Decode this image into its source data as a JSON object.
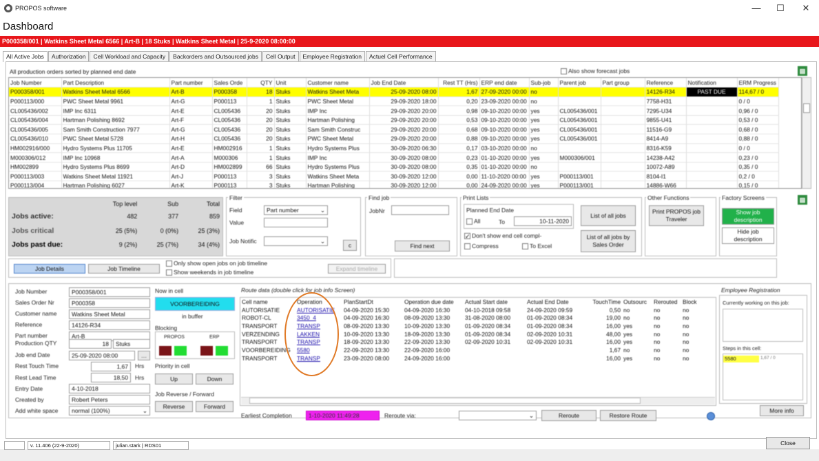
{
  "window": {
    "app_title": "PROPOS software",
    "minimize": "—",
    "maximize": "☐",
    "close": "✕"
  },
  "page_title": "Dashboard",
  "red_bar": "P000358/001  |  Watkins Sheet Metal 6566  |  Art-B  |  18 Stuks  |  Watkins Sheet Metal  |  25-9-2020 08:00:00",
  "tabs": [
    "All Active Jobs",
    "Authorization",
    "Cell Workload and Capacity",
    "Backorders and Outsourced jobs",
    "Cell Output",
    "Employee Registration",
    "Actuel Cell Performance"
  ],
  "grid": {
    "subtitle": "All production orders sorted by planned end date",
    "forecast_label": "Also show forecast jobs",
    "columns": [
      "Job Number",
      "Part Description",
      "Part number",
      "Sales Orde",
      "QTY",
      "Unit",
      "Customer name",
      "Job End Date",
      "Rest TT (Hrs)",
      "ERP end date",
      "Sub-job",
      "Parent job",
      "Part group",
      "Reference",
      "Notification",
      "ERM Progress"
    ],
    "rows": [
      [
        "P000358/001",
        "Watkins Sheet Metal 6566",
        "Art-B",
        "P000358",
        "18",
        "Stuks",
        "Watkins Sheet Meta",
        "25-09-2020 08:00",
        "1,67",
        "27-09-2020 00:00",
        "no",
        "",
        "",
        "14126-R34",
        "PAST DUE",
        "114,67 / 0"
      ],
      [
        "P000113/000",
        "PWC Sheet Metal 9961",
        "Art-G",
        "P000113",
        "1",
        "Stuks",
        "PWC Sheet Metal",
        "29-09-2020 18:00",
        "0,20",
        "23-09-2020 00:00",
        "no",
        "",
        "",
        "7758-H31",
        "",
        "0 / 0"
      ],
      [
        "CL005436/002",
        "IMP Inc 6311",
        "Art-E",
        "CL005436",
        "20",
        "Stuks",
        "IMP Inc",
        "29-09-2020 20:00",
        "0,98",
        "09-10-2020 00:00",
        "yes",
        "CL005436/001",
        "",
        "7295-U34",
        "",
        "0,96 / 0"
      ],
      [
        "CL005436/004",
        "Hartman Polishing 8692",
        "Art-F",
        "CL005436",
        "20",
        "Stuks",
        "Hartman Polishing",
        "29-09-2020 20:00",
        "0,53",
        "09-10-2020 00:00",
        "yes",
        "CL005436/001",
        "",
        "9855-U41",
        "",
        "0,53 / 0"
      ],
      [
        "CL005436/005",
        "Sam Smith Construction 7977",
        "Art-G",
        "CL005436",
        "20",
        "Stuks",
        "Sam Smith Construc",
        "29-09-2020 20:00",
        "0,68",
        "09-10-2020 00:00",
        "yes",
        "CL005436/001",
        "",
        "11516-G9",
        "",
        "0,68 / 0"
      ],
      [
        "CL005436/010",
        "PWC Sheet Metal 5728",
        "Art-H",
        "CL005436",
        "20",
        "Stuks",
        "PWC Sheet Metal",
        "29-09-2020 20:00",
        "0,88",
        "09-10-2020 00:00",
        "yes",
        "CL005436/001",
        "",
        "8414-A9",
        "",
        "0,88 / 0"
      ],
      [
        "HM002916/000",
        "Hydro Systems Plus 11705",
        "Art-E",
        "HM002916",
        "1",
        "Stuks",
        "Hydro Systems Plus",
        "30-09-2020 06:30",
        "0,17",
        "03-10-2020 00:00",
        "no",
        "",
        "",
        "8316-K59",
        "",
        "0 / 0"
      ],
      [
        "M000306/012",
        "IMP Inc 10968",
        "Art-A",
        "M000306",
        "1",
        "Stuks",
        "IMP Inc",
        "30-09-2020 08:00",
        "0,23",
        "01-10-2020 00:00",
        "yes",
        "M000306/001",
        "",
        "14238-A42",
        "",
        "0,23 / 0"
      ],
      [
        "HM002899",
        "Hydro Systems Plus 8699",
        "Art-D",
        "HM002899",
        "66",
        "Stuks",
        "Hydro Systems Plus",
        "30-09-2020 08:00",
        "0,35",
        "01-10-2020 00:00",
        "no",
        "",
        "",
        "10072-A89",
        "",
        "0,35 / 0"
      ],
      [
        "P000113/003",
        "Watkins Sheet Metal 11921",
        "Art-J",
        "P000113",
        "3",
        "Stuks",
        "Watkins Sheet Meta",
        "30-09-2020 12:00",
        "0,00",
        "11-10-2020 00:00",
        "yes",
        "P000113/001",
        "",
        "8104-I1",
        "",
        "0,2 / 0"
      ],
      [
        "P000113/004",
        "Hartman Polishing 6027",
        "Art-K",
        "P000113",
        "3",
        "Stuks",
        "Hartman Polishing",
        "30-09-2020 12:00",
        "0,00",
        "24-09-2020 00:00",
        "yes",
        "P000113/001",
        "",
        "14886-W66",
        "",
        "0,15 / 0"
      ]
    ]
  },
  "stats": {
    "headers": [
      "Top level",
      "Sub",
      "Total"
    ],
    "rows": [
      {
        "label": "Jobs active:",
        "top": "482",
        "sub": "377",
        "total": "859"
      },
      {
        "label": "Jobs critical",
        "top": "25 (5%)",
        "sub": "0 (0%)",
        "total": "25 (3%)"
      },
      {
        "label": "Jobs past due:",
        "top": "9 (2%)",
        "sub": "25 (7%)",
        "total": "34 (4%)"
      }
    ]
  },
  "filter": {
    "title": "Filter",
    "field_label": "Field",
    "field_value": "Part number",
    "value_label": "Value",
    "notific_label": "Job Notific",
    "c_button": "c"
  },
  "find_job": {
    "title": "Find job",
    "jobnr_label": "JobNr",
    "find_next": "Find next"
  },
  "print_lists": {
    "title": "Print Lists",
    "planned_end_date": "Planned End Date",
    "all_label": "All",
    "to_label": "To",
    "to_date": "10-11-2020",
    "dont_show": "Don't show end cell compl-",
    "compress": "Compress",
    "to_excel": "To Excel",
    "list_all_jobs": "List of all jobs",
    "list_by_so": "List of all jobs by Sales Order"
  },
  "other_functions": {
    "title": "Other Functions",
    "print_traveler": "Print PROPOS job Traveler"
  },
  "factory_screens": {
    "title": "Factory Screens",
    "show_desc": "Show job description",
    "hide_desc": "Hide job description"
  },
  "job_tabs": {
    "details": "Job Details",
    "timeline": "Job Timeline",
    "only_open": "Only show open jobs on job timeline",
    "show_weekends": "Show weekends in job timeline",
    "expand": "Expand timeline"
  },
  "details": {
    "fields": [
      {
        "label": "Job Number",
        "value": "P000358/001"
      },
      {
        "label": "Sales Order Nr",
        "value": "P000358"
      },
      {
        "label": "Customer name",
        "value": "Watkins Sheet Metal"
      },
      {
        "label": "Reference",
        "value": "14126-R34"
      },
      {
        "label": "Part number",
        "value": "Art-B"
      }
    ],
    "prod_qty_label": "Production QTY",
    "prod_qty": "18",
    "prod_unit": "Stuks",
    "end_date_label": "Job end Date",
    "end_date": "25-09-2020 08:00",
    "rest_touch_label": "Rest Touch Time",
    "rest_touch": "1,67",
    "hrs": "Hrs",
    "rest_lead_label": "Rest Lead Time",
    "rest_lead": "18,50",
    "entry_label": "Entry Date",
    "entry": "4-10-2018",
    "created_label": "Created by",
    "created": "Robert Peters",
    "white_space_label": "Add white space",
    "white_space": "normal (100%)"
  },
  "now_in_cell": {
    "title": "Now in cell",
    "cell": "VOORBEREIDING",
    "status": "in buffer",
    "blocking": "Blocking",
    "propos": "PROPOS",
    "erp": "ERP",
    "priority": "Priority in cell",
    "up": "Up",
    "down": "Down",
    "reverse_title": "Job Reverse / Forward",
    "reverse": "Reverse",
    "forward": "Forward"
  },
  "route": {
    "title": "Route data (double click for job info Screen)",
    "columns": [
      "Cell name",
      "Operation",
      "PlanStartDt",
      "Operation due date",
      "Actual Start date",
      "Actual End Date",
      "TouchTime",
      "Outsourc",
      "Rerouted",
      "Block"
    ],
    "rows": [
      [
        "AUTORISATIE",
        "AUTORISATIE",
        "04-09-2020 15:30",
        "04-09-2020 16:30",
        "04-10-2018 09:58",
        "24-09-2020 09:59",
        "0,50",
        "no",
        "no",
        "no"
      ],
      [
        "ROBOT-CL",
        "3450_4",
        "04-09-2020 16:30",
        "08-09-2020 13:30",
        "31-08-2020 08:00",
        "01-09-2020 08:34",
        "19,00",
        "no",
        "no",
        "no"
      ],
      [
        "TRANSPORT",
        "TRANSP",
        "08-09-2020 13:30",
        "10-09-2020 13:30",
        "01-09-2020 08:34",
        "01-09-2020 08:34",
        "16,00",
        "yes",
        "no",
        "no"
      ],
      [
        "VERZENDING",
        "LAKKEN",
        "10-09-2020 13:30",
        "18-09-2020 13:30",
        "01-09-2020 08:34",
        "02-09-2020 10:31",
        "48,00",
        "yes",
        "no",
        "no"
      ],
      [
        "TRANSPORT",
        "TRANSP",
        "18-09-2020 13:30",
        "22-09-2020 13:30",
        "02-09-2020 10:31",
        "02-09-2020 10:31",
        "16,00",
        "yes",
        "no",
        "no"
      ],
      [
        "VOORBEREIDING",
        "5580",
        "22-09-2020 13:30",
        "22-09-2020 16:00",
        "",
        "",
        "1,67",
        "no",
        "no",
        "no"
      ],
      [
        "TRANSPORT",
        "TRANSP",
        "23-09-2020 08:00",
        "24-09-2020 16:00",
        "",
        "",
        "16,00",
        "yes",
        "no",
        "no"
      ]
    ],
    "earliest_label": "Earliest Completion",
    "earliest": "1-10-2020 11:49:28",
    "reroute_via": "Reroute via:",
    "reroute": "Reroute",
    "restore": "Restore Route"
  },
  "employee": {
    "title": "Employee Registration",
    "working": "Currently working on this job:",
    "steps": "Steps in this cell:",
    "step_cell": "5580",
    "step_val": "1,67 / 0",
    "more_info": "More info"
  },
  "statusbar": {
    "version": "v. 11.406 (22-9-2020)",
    "user": "julian.stark | RDS01",
    "close": "Close"
  },
  "colors": {
    "accent_red": "#e8161b",
    "highlight_yellow": "#ffff00",
    "green": "#21b14a",
    "magenta": "#ee22ee",
    "cyan": "#22ddee",
    "annotation_orange": "#e07a27"
  }
}
